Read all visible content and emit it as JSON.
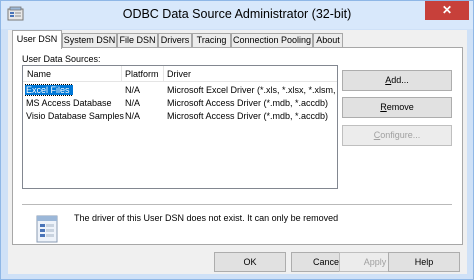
{
  "window": {
    "title": "ODBC Data Source Administrator (32-bit)",
    "close_glyph": "✕"
  },
  "tabs": [
    {
      "label": "User DSN",
      "active": true
    },
    {
      "label": "System DSN"
    },
    {
      "label": "File DSN"
    },
    {
      "label": "Drivers"
    },
    {
      "label": "Tracing"
    },
    {
      "label": "Connection Pooling"
    },
    {
      "label": "About"
    }
  ],
  "user_dsn": {
    "section_label": "User Data Sources:",
    "columns": [
      "Name",
      "Platform",
      "Driver"
    ],
    "rows": [
      {
        "name": "Excel Files",
        "platform": "N/A",
        "driver": "Microsoft Excel Driver (*.xls, *.xlsx, *.xlsm, *.xls",
        "selected": true
      },
      {
        "name": "MS Access Database",
        "platform": "N/A",
        "driver": "Microsoft Access Driver (*.mdb, *.accdb)"
      },
      {
        "name": "Visio Database Samples",
        "platform": "N/A",
        "driver": "Microsoft Access Driver (*.mdb, *.accdb)"
      }
    ],
    "buttons": {
      "add": {
        "key": "A",
        "rest": "dd..."
      },
      "remove": {
        "key": "R",
        "rest": "emove"
      },
      "configure": {
        "key": "C",
        "rest": "onfigure..."
      }
    },
    "info_text": "The driver of this User DSN does not exist. It can only be removed"
  },
  "footer": {
    "ok": "OK",
    "cancel": "Cancel",
    "apply": "Apply",
    "help": "Help"
  }
}
